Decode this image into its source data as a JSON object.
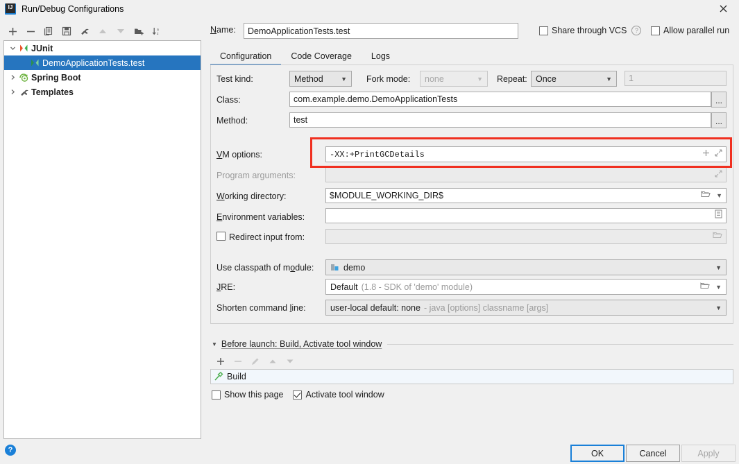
{
  "window": {
    "title": "Run/Debug Configurations",
    "app_icon": "intellij-idea-icon",
    "close_icon": "close-icon"
  },
  "left_toolbar": {
    "buttons": [
      {
        "name": "add-configuration-button",
        "icon": "plus-icon",
        "label": "+",
        "enabled": true
      },
      {
        "name": "remove-configuration-button",
        "icon": "minus-icon",
        "label": "−",
        "enabled": true
      },
      {
        "name": "copy-configuration-button",
        "icon": "copy-icon",
        "label": "copy",
        "enabled": true
      },
      {
        "name": "save-configuration-button",
        "icon": "save-icon",
        "label": "save",
        "enabled": true
      },
      {
        "name": "edit-templates-button",
        "icon": "wrench-icon",
        "label": "wrench",
        "enabled": true
      },
      {
        "name": "move-up-button",
        "icon": "arrow-up-icon",
        "label": "up",
        "enabled": false
      },
      {
        "name": "move-down-button",
        "icon": "arrow-down-icon",
        "label": "down",
        "enabled": false
      },
      {
        "name": "create-folder-button",
        "icon": "new-folder-icon",
        "label": "folder",
        "enabled": true
      },
      {
        "name": "sort-configurations-button",
        "icon": "sort-alpha-icon",
        "label": "sort",
        "enabled": true
      }
    ]
  },
  "tree": {
    "nodes": [
      {
        "label": "JUnit",
        "icon": "junit-icon",
        "expanded": true,
        "level": 0,
        "selected": false,
        "bold": true
      },
      {
        "label": "DemoApplicationTests.test",
        "icon": "junit-run-icon",
        "expanded": null,
        "level": 1,
        "selected": true,
        "bold": false
      },
      {
        "label": "Spring Boot",
        "icon": "spring-boot-icon",
        "expanded": false,
        "level": 0,
        "selected": false,
        "bold": true
      },
      {
        "label": "Templates",
        "icon": "wrench-icon",
        "expanded": false,
        "level": 0,
        "selected": false,
        "bold": true
      }
    ]
  },
  "header": {
    "name_label": "Name:",
    "name_label_mnemonic": "N",
    "name_value": "DemoApplicationTests.test",
    "share_vcs_label": "Share through VCS",
    "share_vcs_checked": false,
    "share_help_icon": "question-mark-icon",
    "allow_parallel_label": "Allow parallel run",
    "allow_parallel_checked": false
  },
  "tabs": [
    {
      "label": "Configuration",
      "name": "tab-configuration",
      "active": true
    },
    {
      "label": "Code Coverage",
      "name": "tab-code-coverage",
      "active": false
    },
    {
      "label": "Logs",
      "name": "tab-logs",
      "active": false
    }
  ],
  "configuration": {
    "test_kind_label": "Test kind:",
    "test_kind_value": "Method",
    "fork_mode_label": "Fork mode:",
    "fork_mode_value": "none",
    "fork_mode_enabled": false,
    "repeat_label": "Repeat:",
    "repeat_value": "Once",
    "repeat_count_value": "1",
    "repeat_count_enabled": false,
    "class_label": "Class:",
    "class_value": "com.example.demo.DemoApplicationTests",
    "class_browse_label": "...",
    "method_label": "Method:",
    "method_value": "test",
    "method_browse_label": "...",
    "vm_options_label": "VM options:",
    "vm_options_value": "-XX:+PrintGCDetails",
    "vm_options_add_icon": "plus-icon",
    "vm_options_expand_icon": "expand-icon",
    "program_arguments_label": "Program arguments:",
    "program_arguments_value": "",
    "program_arguments_enabled": false,
    "program_arguments_expand_icon": "expand-icon",
    "working_directory_label": "Working directory:",
    "working_directory_value": "$MODULE_WORKING_DIR$",
    "working_directory_browse_icon": "folder-icon",
    "working_directory_dropdown_icon": "chevron-down-icon",
    "environment_variables_label": "Environment variables:",
    "environment_variables_value": "",
    "environment_variables_icon": "list-edit-icon",
    "redirect_input_label": "Redirect input from:",
    "redirect_input_checked": false,
    "redirect_input_value": "",
    "redirect_input_browse_icon": "folder-icon",
    "use_classpath_label": "Use classpath of module:",
    "use_classpath_value": "demo",
    "use_classpath_icon": "module-icon",
    "jre_label": "JRE:",
    "jre_value": "Default",
    "jre_value_hint": "(1.8 - SDK of 'demo' module)",
    "jre_browse_icon": "folder-icon",
    "jre_dropdown_icon": "chevron-down-icon",
    "shorten_command_line_label": "Shorten command line:",
    "shorten_command_line_value": "user-local default: none",
    "shorten_command_line_hint": "- java [options] classname [args]",
    "shorten_dropdown_icon": "chevron-down-icon"
  },
  "before_launch": {
    "header": "Before launch: Build, Activate tool window",
    "collapse_icon": "triangle-down-icon",
    "toolbar": [
      {
        "name": "add-before-launch-task-button",
        "icon": "plus-icon",
        "label": "+",
        "enabled": true
      },
      {
        "name": "remove-before-launch-task-button",
        "icon": "minus-icon",
        "label": "−",
        "enabled": false
      },
      {
        "name": "edit-before-launch-task-button",
        "icon": "pencil-icon",
        "label": "edit",
        "enabled": false
      },
      {
        "name": "move-task-up-button",
        "icon": "arrow-up-icon",
        "label": "up",
        "enabled": false
      },
      {
        "name": "move-task-down-button",
        "icon": "arrow-down-icon",
        "label": "down",
        "enabled": false
      }
    ],
    "tasks": [
      {
        "label": "Build",
        "icon": "build-hammer-icon"
      }
    ],
    "show_page_label": "Show this page",
    "show_page_checked": false,
    "activate_tool_window_label": "Activate tool window",
    "activate_tool_window_checked": true
  },
  "footer": {
    "help_icon": "help-question-icon",
    "ok_label": "OK",
    "cancel_label": "Cancel",
    "apply_label": "Apply",
    "apply_enabled": false
  },
  "colors": {
    "selection_blue": "#2675bf",
    "accent_blue": "#3d7ec0",
    "focus_blue": "#1a80d8",
    "highlight_red": "#f03020",
    "dialog_bg": "#f0f0f0",
    "field_bg": "#ffffff",
    "disabled_bg": "#ebebeb"
  }
}
